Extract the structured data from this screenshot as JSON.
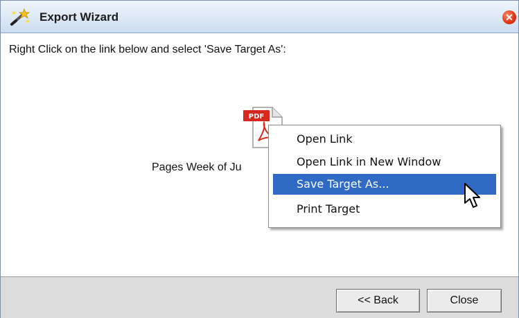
{
  "window": {
    "title": "Export Wizard",
    "close_glyph": "✕"
  },
  "instruction": "Right Click on the link below and select 'Save Target As':",
  "file": {
    "icon": "pdf-icon",
    "icon_label": "PDF",
    "link_text": "Pages Week of Ju"
  },
  "context_menu": {
    "items": [
      {
        "label": "Open Link"
      },
      {
        "label": "Open Link in New Window"
      },
      {
        "label": "Save Target As..."
      },
      {
        "label": "Print Target"
      }
    ],
    "selected": "Save Target As...",
    "highlight_color": "#316ac5"
  },
  "footer": {
    "back_label": "<< Back",
    "close_label": "Close"
  }
}
